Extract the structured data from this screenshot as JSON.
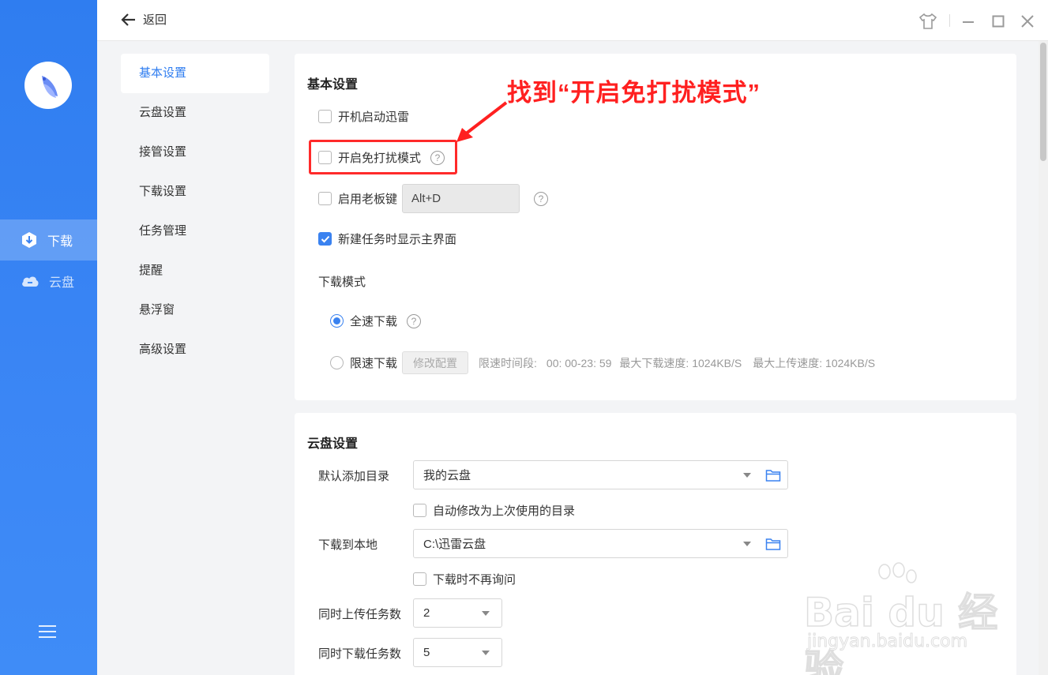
{
  "sidebar": {
    "items": [
      {
        "label": "下载"
      },
      {
        "label": "云盘"
      }
    ]
  },
  "topbar": {
    "back_label": "返回"
  },
  "nav": {
    "items": [
      {
        "label": "基本设置"
      },
      {
        "label": "云盘设置"
      },
      {
        "label": "接管设置"
      },
      {
        "label": "下载设置"
      },
      {
        "label": "任务管理"
      },
      {
        "label": "提醒"
      },
      {
        "label": "悬浮窗"
      },
      {
        "label": "高级设置"
      }
    ]
  },
  "basic": {
    "title": "基本设置",
    "startup_label": "开机启动迅雷",
    "dnd_label": "开启免打扰模式",
    "boss_key_label": "启用老板键",
    "boss_key_value": "Alt+D",
    "show_main_label": "新建任务时显示主界面",
    "download_mode_label": "下载模式",
    "full_speed_label": "全速下载",
    "limited_label": "限速下载",
    "modify_config_label": "修改配置",
    "limit_period": "限速时间段:",
    "limit_time": "00: 00-23: 59",
    "max_download": "最大下载速度: 1024KB/S",
    "max_upload": "最大上传速度: 1024KB/S"
  },
  "cloud": {
    "title": "云盘设置",
    "default_dir_label": "默认添加目录",
    "default_dir_value": "我的云盘",
    "auto_modify_label": "自动修改为上次使用的目录",
    "local_label": "下载到本地",
    "local_value": "C:\\迅雷云盘",
    "no_ask_label": "下载时不再询问",
    "upload_tasks_label": "同时上传任务数",
    "upload_tasks_value": "2",
    "download_tasks_label": "同时下载任务数",
    "download_tasks_value": "5"
  },
  "annotation": {
    "text": "找到“开启免打扰模式”"
  },
  "watermark": {
    "brand": "Bai du 经验",
    "url": "jingyan.baidu.com"
  },
  "colors": {
    "accent": "#2f7df0",
    "annotation": "#ff2a2a"
  }
}
